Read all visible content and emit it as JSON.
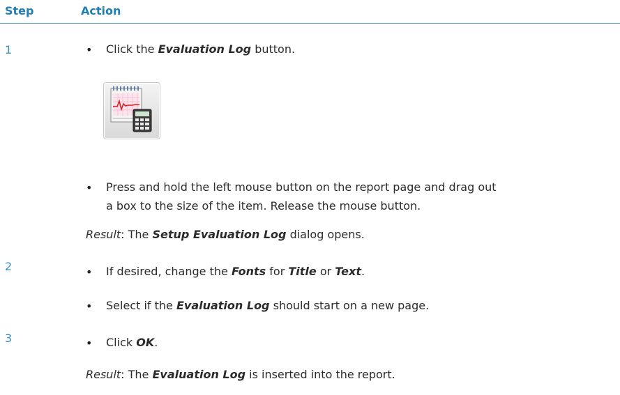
{
  "header": {
    "step_label": "Step",
    "action_label": "Action"
  },
  "colors": {
    "accent": "#1f7fb6",
    "rule": "#5aa5cf"
  },
  "steps": [
    {
      "number": "1",
      "bullets": [
        {
          "pre": "Click the ",
          "em1": "Evaluation Log",
          "post": " button."
        },
        {
          "line1": "Press and hold the left mouse button on the report page and drag out",
          "line2": "a box to the size of the item. Release the mouse button."
        }
      ],
      "icon_name": "evaluation-log-icon",
      "result": {
        "label": "Result",
        "pre": ": The ",
        "em": "Setup Evaluation Log",
        "post": " dialog opens."
      }
    },
    {
      "number": "2",
      "bullets": [
        {
          "pre": "If desired, change the ",
          "em1": "Fonts",
          "mid1": " for ",
          "em2": "Title",
          "mid2": " or ",
          "em3": "Text",
          "post": "."
        },
        {
          "pre": "Select if the ",
          "em1": "Evaluation Log",
          "post": " should start on a new page."
        }
      ]
    },
    {
      "number": "3",
      "bullets": [
        {
          "pre": "Click ",
          "em1": "OK",
          "post": "."
        }
      ],
      "result": {
        "label": "Result",
        "pre": ": The ",
        "em": "Evaluation Log",
        "post": " is inserted into the report."
      }
    }
  ],
  "bullet_glyph": "•"
}
